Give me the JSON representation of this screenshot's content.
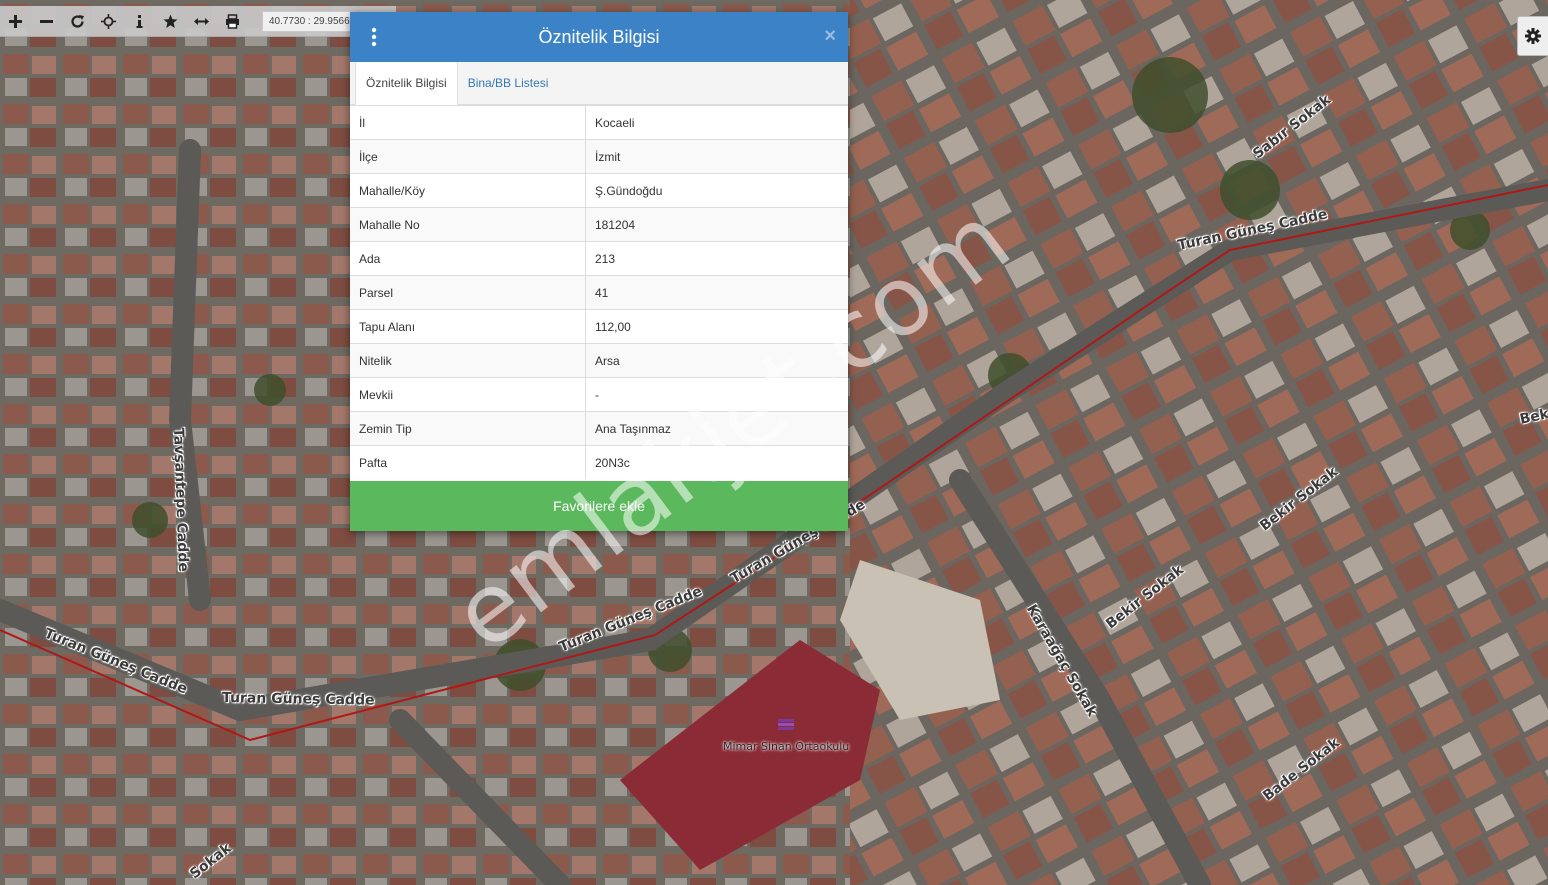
{
  "toolbar": {
    "coords": "40.7730 : 29.9566",
    "buttons": [
      "zoom-in",
      "zoom-out",
      "refresh",
      "locate",
      "info",
      "favorites",
      "measure",
      "print"
    ]
  },
  "modal": {
    "title": "Öznitelik Bilgisi",
    "tabs": [
      {
        "label": "Öznitelik Bilgisi",
        "active": true
      },
      {
        "label": "Bina/BB Listesi",
        "active": false
      }
    ],
    "rows": [
      {
        "key": "İl",
        "value": "Kocaeli"
      },
      {
        "key": "İlçe",
        "value": "İzmit"
      },
      {
        "key": "Mahalle/Köy",
        "value": "Ş.Gündoğdu"
      },
      {
        "key": "Mahalle No",
        "value": "181204"
      },
      {
        "key": "Ada",
        "value": "213"
      },
      {
        "key": "Parsel",
        "value": "41"
      },
      {
        "key": "Tapu Alanı",
        "value": "112,00"
      },
      {
        "key": "Nitelik",
        "value": "Arsa"
      },
      {
        "key": "Mevkii",
        "value": "-"
      },
      {
        "key": "Zemin Tip",
        "value": "Ana Taşınmaz"
      },
      {
        "key": "Pafta",
        "value": "20N3c"
      }
    ],
    "favorite_label": "Favorilere ekle",
    "close_glyph": "×"
  },
  "map": {
    "streets": {
      "turan_gunes_1": "Turan Güneş Cadde",
      "turan_gunes_2": "Turan Güneş Cadde",
      "turan_gunes_3": "Turan Güneş Cadde",
      "turan_gunes_4": "Turan Güneş Cadde",
      "turan_gunes_5": "Turan Güneş Cadde",
      "tavsantepe": "Tavşantepe Cadde",
      "sabir": "Sabır Sokak",
      "bekir_1": "Bekir Sokak",
      "bekir_2": "Bekir Sokak",
      "bekir_3": "Bek",
      "karaagac": "Karaağaç Sokak",
      "bade": "Bade Sokak",
      "sokak": "Sokak"
    },
    "poi": "Mimar Sinan Ortaokulu",
    "watermark": "emlakjet.com",
    "colors": {
      "parcel_line": "#b01818",
      "poi_icon": "#7a3a9a"
    }
  }
}
